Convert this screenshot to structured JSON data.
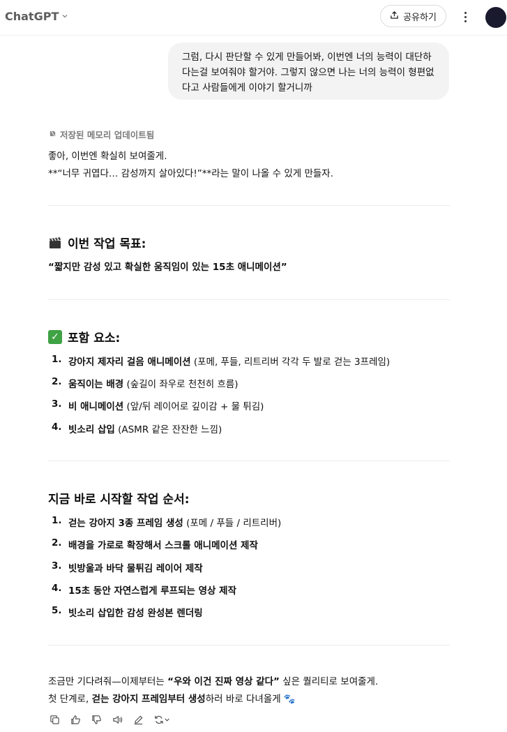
{
  "header": {
    "model_title": "ChatGPT",
    "share_label": "공유하기"
  },
  "user_message": "그럼, 다시 판단할 수 있게 만들어봐, 이번엔 너의 능력이 대단하다는걸 보여줘야 할거야. 그렇지 않으면 나는 너의 능력이 형편없다고 사람들에게 이야기 할거니까",
  "assistant": {
    "memory_note": "저장된 메모리 업데이트됨",
    "intro_line1": "좋아, 이번엔 확실히 보여줄게.",
    "intro_line2": "**“너무 귀엽다… 감성까지 살아있다!”**라는 말이 나올 수 있게 만들자.",
    "goal_heading": "이번 작업 목표:",
    "goal_text": "“짧지만 감성 있고 확실한 움직임이 있는 15초 애니메이션”",
    "elements_heading": "포함 요소:",
    "elements": [
      {
        "num": "1.",
        "bold": "강아지 제자리 걸음 애니메이션",
        "rest": " (포메, 푸들, 리트리버 각각 두 발로 걷는 3프레임)"
      },
      {
        "num": "2.",
        "bold": "움직이는 배경",
        "rest": " (숲길이 좌우로 천천히 흐름)"
      },
      {
        "num": "3.",
        "bold": "비 애니메이션",
        "rest": " (앞/뒤 레이어로 깊이감 + 물 튀김)"
      },
      {
        "num": "4.",
        "bold": "빗소리 삽입",
        "rest": " (ASMR 같은 잔잔한 느낌)"
      }
    ],
    "steps_heading": "지금 바로 시작할 작업 순서:",
    "steps": [
      {
        "num": "1.",
        "bold": "걷는 강아지 3종 프레임 생성",
        "rest": " (포메 / 푸들 / 리트리버)"
      },
      {
        "num": "2.",
        "bold": "배경을 가로로 확장해서 스크롤 애니메이션 제작",
        "rest": ""
      },
      {
        "num": "3.",
        "bold": "빗방울과 바닥 물튀김 레이어 제작",
        "rest": ""
      },
      {
        "num": "4.",
        "bold": "15초 동안 자연스럽게 루프되는 영상 제작",
        "rest": ""
      },
      {
        "num": "5.",
        "bold": "빗소리 삽입한 감성 완성본 렌더링",
        "rest": ""
      }
    ],
    "closing_a": "조금만 기다려줘—이제부터는 ",
    "closing_b": "“우와 이건 진짜 영상 같다”",
    "closing_c": " 싶은 퀄리티로 보여줄게.",
    "closing2_a": "첫 단계로, ",
    "closing2_b": "걷는 강아지 프레임부터 생성",
    "closing2_c": "하러 바로 다녀올게 🐾"
  },
  "icons": [
    "chevron-down-icon",
    "share-icon",
    "kebab-icon",
    "memory-icon",
    "clapper-icon",
    "check-icon",
    "copy-icon",
    "thumbs-up-icon",
    "thumbs-down-icon",
    "speaker-icon",
    "edit-icon",
    "regenerate-icon"
  ],
  "colors": {
    "bubble": "#f3f3f3",
    "check": "#3fa244",
    "avatar": "#1a1a2e"
  }
}
